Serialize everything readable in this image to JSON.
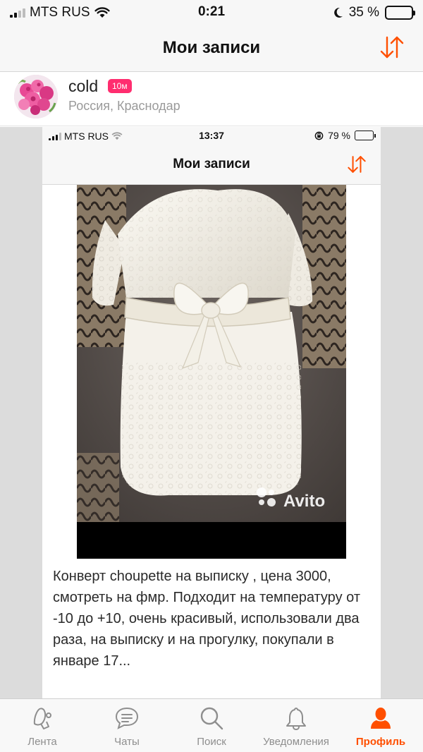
{
  "status_bar": {
    "carrier": "MTS RUS",
    "time": "0:21",
    "battery_percent": "35 %",
    "battery_level": 0.35
  },
  "nav": {
    "title": "Мои записи",
    "sort_icon": "sort-arrows-icon",
    "accent_color": "#ff4f00"
  },
  "profile": {
    "username": "cold",
    "badge": "10м",
    "badge_color": "#ff2d6f",
    "location": "Россия, Краснодар"
  },
  "post": {
    "embedded_screenshot": {
      "carrier": "MTS RUS",
      "time": "13:37",
      "battery_percent": "79 %",
      "battery_level": 0.79,
      "title": "Мои записи"
    },
    "photo_watermark": "Avito",
    "text": "Конверт choupette на выписку , цена 3000, смотреть на фмр. Подходит на температуру от -10 до +10, очень красивый, использовали два раза, на выписку и на прогулку, покупали в январе 17..."
  },
  "tab_bar": {
    "tabs": [
      {
        "label": "Лента",
        "icon": "feed-icon"
      },
      {
        "label": "Чаты",
        "icon": "chat-icon"
      },
      {
        "label": "Поиск",
        "icon": "search-icon"
      },
      {
        "label": "Уведомления",
        "icon": "bell-icon"
      },
      {
        "label": "Профиль",
        "icon": "profile-icon",
        "active": true
      }
    ]
  }
}
